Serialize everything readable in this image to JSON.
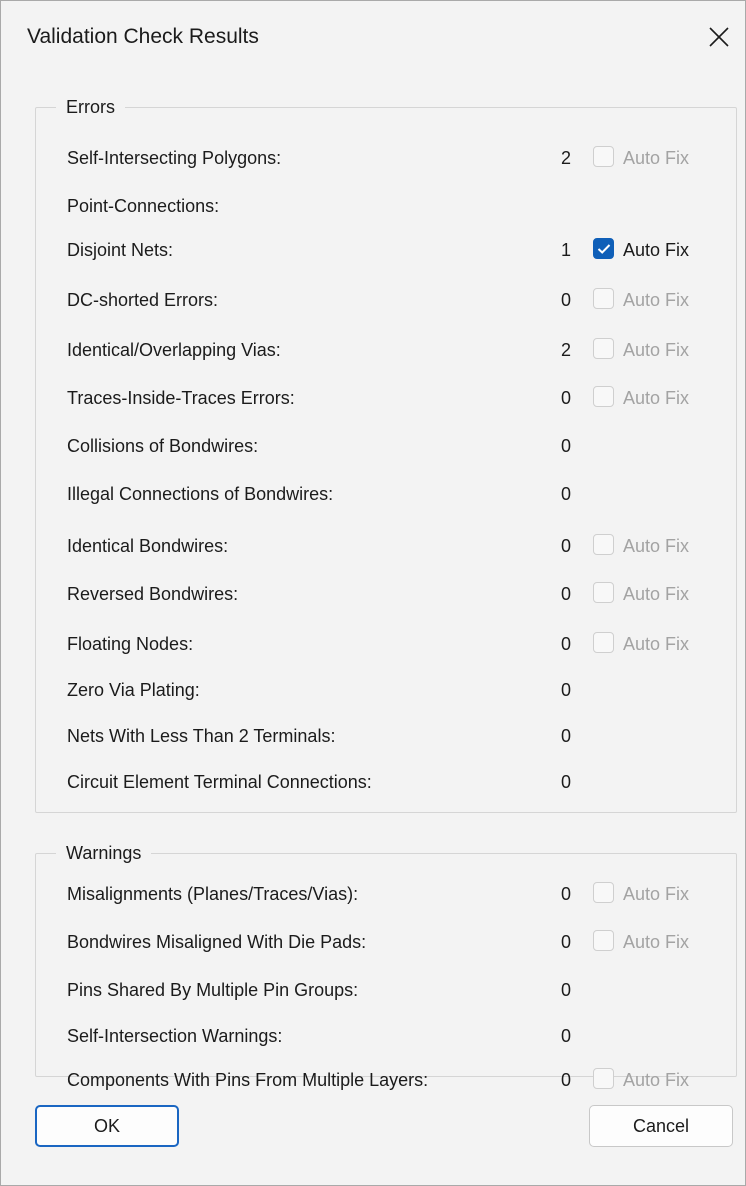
{
  "dialog": {
    "title": "Validation Check Results"
  },
  "errors": {
    "legend": "Errors",
    "rows": [
      {
        "label": "Self-Intersecting Polygons:",
        "count": "2",
        "autofix": true,
        "checked": false,
        "enabled": false
      },
      {
        "label": "Point-Connections:",
        "count": "",
        "autofix": false
      },
      {
        "label": "Disjoint Nets:",
        "count": "1",
        "autofix": true,
        "checked": true,
        "enabled": true
      },
      {
        "label": "DC-shorted Errors:",
        "count": "0",
        "autofix": true,
        "checked": false,
        "enabled": false
      },
      {
        "label": "Identical/Overlapping Vias:",
        "count": "2",
        "autofix": true,
        "checked": false,
        "enabled": false
      },
      {
        "label": "Traces-Inside-Traces Errors:",
        "count": "0",
        "autofix": true,
        "checked": false,
        "enabled": false
      },
      {
        "label": "Collisions of Bondwires:",
        "count": "0",
        "autofix": false
      },
      {
        "label": "Illegal Connections of Bondwires:",
        "count": "0",
        "autofix": false
      },
      {
        "label": "Identical Bondwires:",
        "count": "0",
        "autofix": true,
        "checked": false,
        "enabled": false
      },
      {
        "label": "Reversed Bondwires:",
        "count": "0",
        "autofix": true,
        "checked": false,
        "enabled": false
      },
      {
        "label": "Floating Nodes:",
        "count": "0",
        "autofix": true,
        "checked": false,
        "enabled": false
      },
      {
        "label": "Zero Via Plating:",
        "count": "0",
        "autofix": false
      },
      {
        "label": "Nets With Less Than 2 Terminals:",
        "count": "0",
        "autofix": false
      },
      {
        "label": "Circuit Element Terminal Connections:",
        "count": "0",
        "autofix": false
      }
    ]
  },
  "warnings": {
    "legend": "Warnings",
    "rows": [
      {
        "label": "Misalignments (Planes/Traces/Vias):",
        "count": "0",
        "autofix": true,
        "checked": false,
        "enabled": false
      },
      {
        "label": "Bondwires Misaligned With Die Pads:",
        "count": "0",
        "autofix": true,
        "checked": false,
        "enabled": false
      },
      {
        "label": "Pins Shared By Multiple Pin Groups:",
        "count": "0",
        "autofix": false
      },
      {
        "label": "Self-Intersection Warnings:",
        "count": "0",
        "autofix": false
      },
      {
        "label": "Components With Pins From Multiple Layers:",
        "count": "0",
        "autofix": true,
        "checked": false,
        "enabled": false
      }
    ]
  },
  "autofix_label": "Auto Fix",
  "buttons": {
    "ok": "OK",
    "cancel": "Cancel"
  },
  "icons": {
    "close": "close-icon",
    "check": "checkmark-icon"
  },
  "colors": {
    "accent": "#0f5fb8",
    "ok_border": "#1a66c2",
    "disabled_text": "#a3a3a3"
  }
}
